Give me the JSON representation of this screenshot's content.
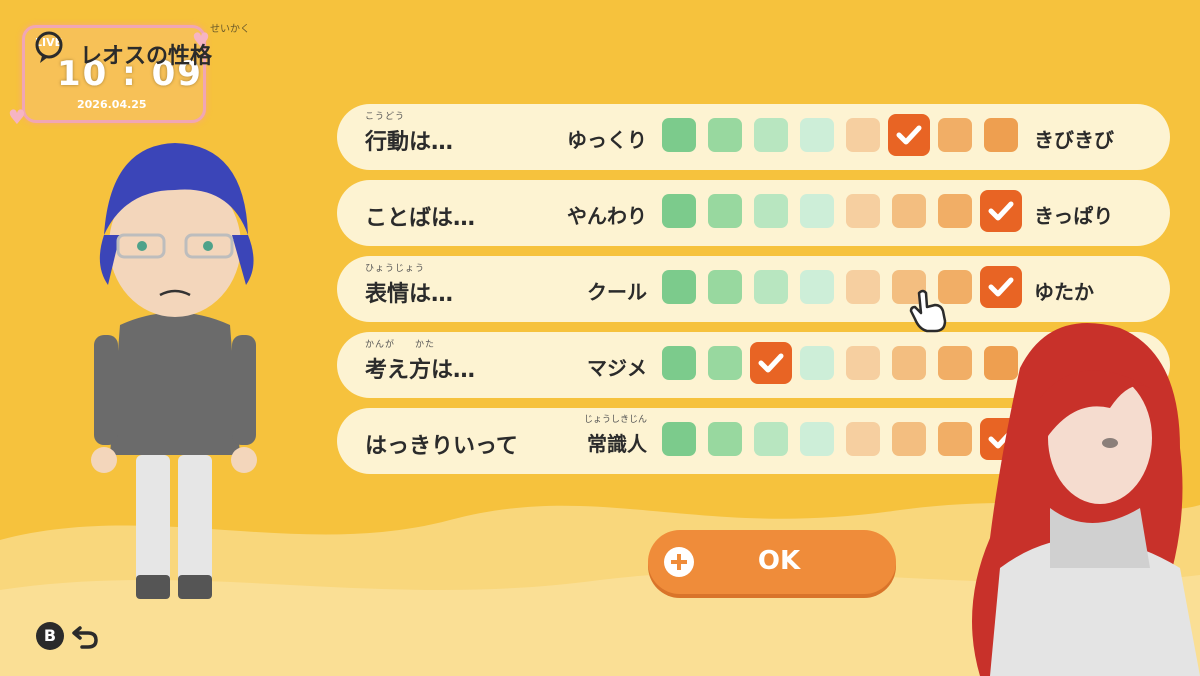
{
  "header": {
    "title": "レオスの性格",
    "title_ruby": "せいかく"
  },
  "stream_overlay": {
    "live_label": "LIVE",
    "time": "10 : 09",
    "date": "2026.04.25"
  },
  "traits": [
    {
      "label": "行動は…",
      "ruby": "こうどう",
      "left_ruby": "",
      "left": "ゆっくり",
      "right": "きびきび",
      "selected": 6,
      "scale": 8
    },
    {
      "label": "ことばは…",
      "ruby": "",
      "left_ruby": "",
      "left": "やんわり",
      "right": "きっぱり",
      "selected": 8,
      "scale": 8
    },
    {
      "label": "表情は…",
      "ruby": "ひょうじょう",
      "left_ruby": "",
      "left": "クール",
      "right": "ゆたか",
      "selected": 8,
      "scale": 8
    },
    {
      "label": "考え方は…",
      "ruby": "かんが　　かた",
      "left_ruby": "",
      "left": "マジメ",
      "right": "",
      "selected": 3,
      "scale": 8
    },
    {
      "label": "はっきりいって",
      "ruby": "",
      "left_ruby": "じょうしきじん",
      "left": "常識人",
      "right": "",
      "selected": 8,
      "scale": 8
    }
  ],
  "ok_button": {
    "label": "OK"
  },
  "controls": {
    "back_button": "B"
  },
  "colors": {
    "background": "#f6c23d",
    "row_bg": "#fdf3d2",
    "selected": "#e86424",
    "scale": [
      "#7ccb8c",
      "#98d89f",
      "#b8e6c0",
      "#cdeed8",
      "#f6cfa0",
      "#f3be80",
      "#f1ae66",
      "#ee9f50"
    ],
    "ok_button": "#ef8c3a"
  }
}
